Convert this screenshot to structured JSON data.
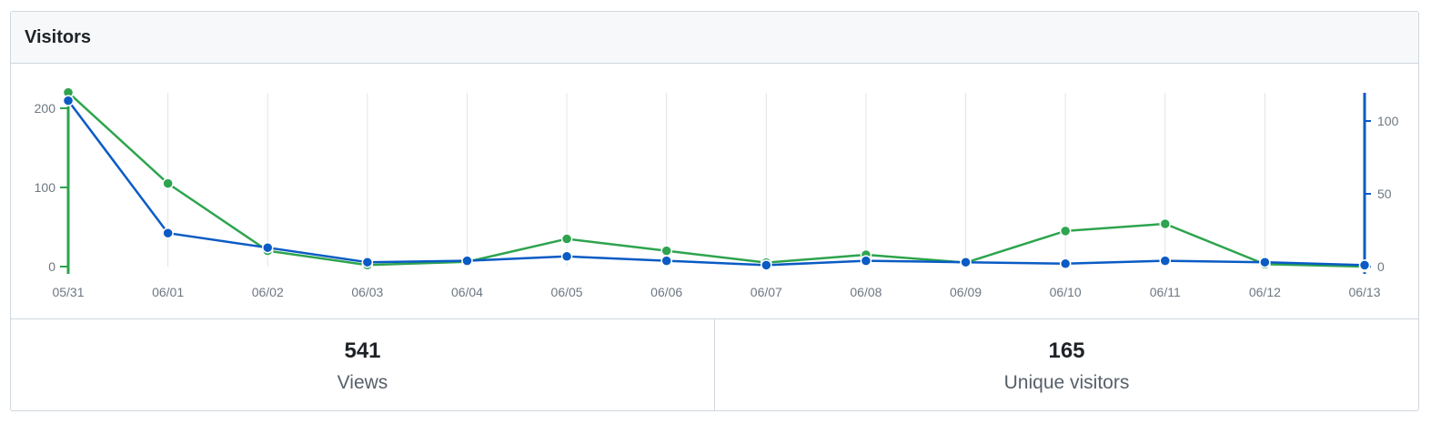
{
  "title": "Visitors",
  "stats": {
    "views": {
      "value": "541",
      "label": "Views"
    },
    "unique": {
      "value": "165",
      "label": "Unique visitors"
    }
  },
  "colors": {
    "views": "#2da44e",
    "unique": "#0a5bc4",
    "grid": "#e1e4e8",
    "tick": "#6e7781"
  },
  "chart_data": {
    "type": "line",
    "title": "Visitors",
    "categories": [
      "05/31",
      "06/01",
      "06/02",
      "06/03",
      "06/04",
      "06/05",
      "06/06",
      "06/07",
      "06/08",
      "06/09",
      "06/10",
      "06/11",
      "06/12",
      "06/13"
    ],
    "series": [
      {
        "name": "Views",
        "axis": "left",
        "color": "#2da44e",
        "values": [
          220,
          105,
          20,
          2,
          6,
          35,
          20,
          5,
          15,
          5,
          45,
          54,
          3,
          0
        ]
      },
      {
        "name": "Unique visitors",
        "axis": "right",
        "color": "#0a5bc4",
        "values": [
          114,
          23,
          13,
          3,
          4,
          7,
          4,
          1,
          4,
          3,
          2,
          4,
          3,
          1
        ]
      }
    ],
    "y_left": {
      "ticks": [
        0,
        100,
        200
      ],
      "ylim": [
        0,
        220
      ]
    },
    "y_right": {
      "ticks": [
        0,
        50,
        100
      ],
      "ylim": [
        0,
        120
      ]
    },
    "grid": "vertical",
    "legend": "none"
  }
}
